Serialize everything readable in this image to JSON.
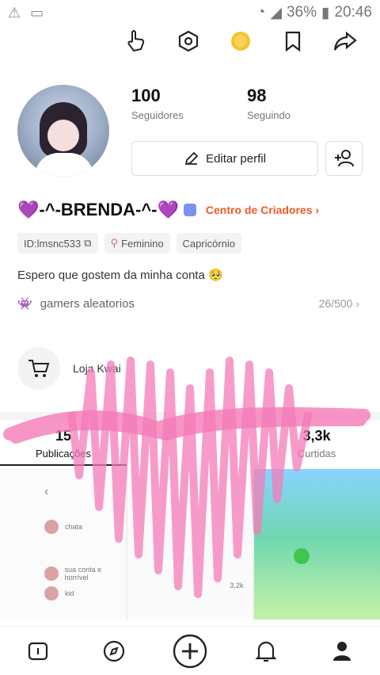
{
  "status_bar": {
    "battery": "36%",
    "time": "20:46"
  },
  "profile": {
    "followers_count": "100",
    "followers_label": "Seguidores",
    "following_count": "98",
    "following_label": "Seguindo",
    "edit_label": "Editar perfil",
    "name": "💜-^-BRENDA-^-💜",
    "creator_link": "Centro de Criadores ›",
    "tags": [
      "ID:lmsnc533",
      "Feminino",
      "Capricórnio"
    ],
    "bio": "Espero que gostem da minha conta 🥺",
    "group_name": "gamers aleatorios",
    "group_count": "26/500 ›",
    "shop_label": "Loja Kwai"
  },
  "tabs": [
    {
      "num": "15",
      "label": "Publicações"
    },
    {
      "num": "",
      "label": ""
    },
    {
      "num": "3,3k",
      "label": "Curtidas"
    }
  ],
  "grid": {
    "cell1_rows": [
      "chata",
      "sua conta e horrível",
      "kid"
    ],
    "cell2_label": "3,2k"
  },
  "colors": {
    "accent": "#ef5a24",
    "scribble": "#f47bb8",
    "coin": "#f5c32c"
  }
}
